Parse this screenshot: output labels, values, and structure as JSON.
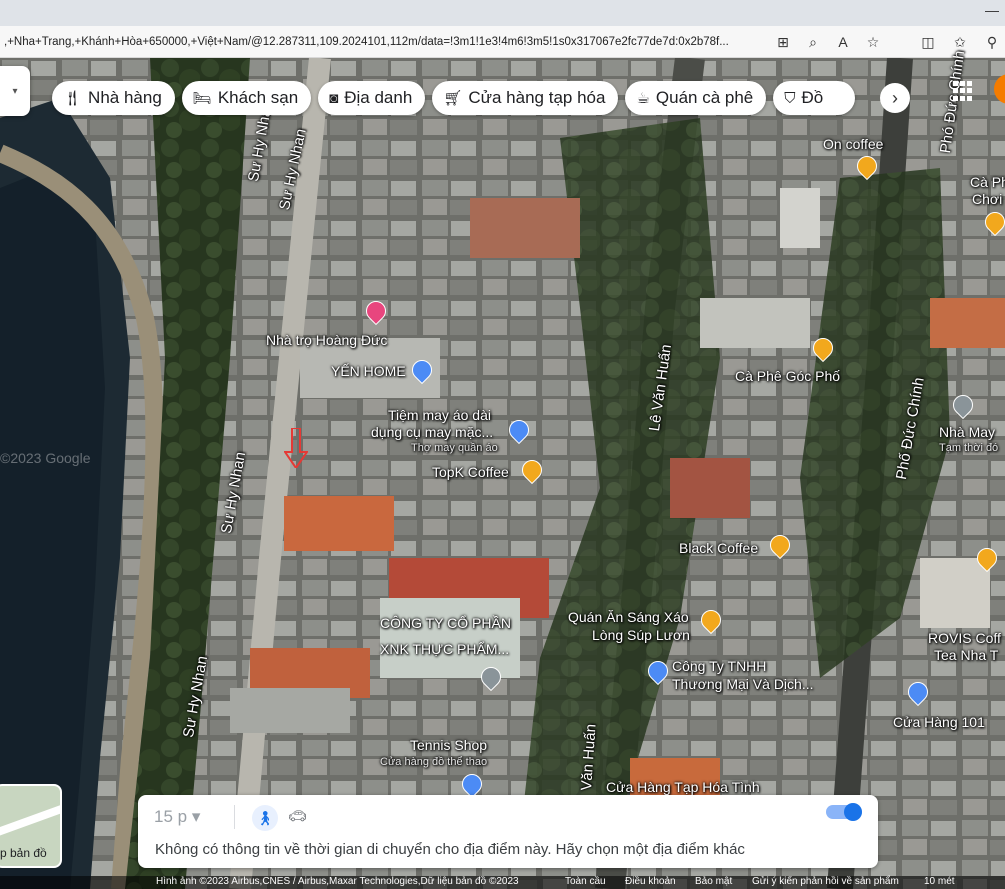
{
  "browser": {
    "url": ",+Nha+Trang,+Khánh+Hòa+650000,+Việt+Nam/@12.287311,109.2024101,112m/data=!3m1!1e3!4m6!3m5!1s0x317067e2fc77de7d:0x2b78f..."
  },
  "chips": [
    {
      "label": "Nhà hàng",
      "icon": "restaurant-icon"
    },
    {
      "label": "Khách sạn",
      "icon": "hotel-icon"
    },
    {
      "label": "Địa danh",
      "icon": "landmark-icon"
    },
    {
      "label": "Cửa hàng tạp hóa",
      "icon": "cart-icon"
    },
    {
      "label": "Quán cà phê",
      "icon": "coffee-icon"
    },
    {
      "label": "Đồ",
      "icon": "shopping-bag-icon"
    }
  ],
  "map": {
    "streets": [
      "Sư Hy Nhan",
      "Sư Hy Nhan",
      "Sư Hy Nhan",
      "Sư Hy Nhan",
      "Lê Văn Huấn",
      "Phó Đức Chính",
      "Phố Đức Chính",
      "Văn Huấn"
    ],
    "places": [
      {
        "name": "On coffee",
        "type": "cafe"
      },
      {
        "name": "Cà Phê Góc Phố",
        "type": "cafe"
      },
      {
        "name": "Nhà trọ Hoàng Đức",
        "type": "hotel"
      },
      {
        "name": "YẾN HOME",
        "type": "shop"
      },
      {
        "name": "Tiệm may áo dài",
        "sub": "dụng cụ may mặc...",
        "sub2": "Thợ may quần áo",
        "type": "shop"
      },
      {
        "name": "TopK Coffee",
        "type": "cafe"
      },
      {
        "name": "Black Coffee",
        "type": "cafe"
      },
      {
        "name": "Quán Ăn Sáng Xáo",
        "sub": "Lòng Súp Lươn",
        "type": "food"
      },
      {
        "name": "CÔNG TY CỔ PHẦN",
        "sub": "XNK THỰC PHẨM...",
        "type": "grey"
      },
      {
        "name": "Công Ty TNHH",
        "sub": "Thương Mại Và Dịch...",
        "type": "shop"
      },
      {
        "name": "Tennis Shop",
        "sub": "Cửa hàng đồ thể thao",
        "type": "shop"
      },
      {
        "name": "Cửa Hàng Tạp Hóa Tình",
        "type": "shop"
      },
      {
        "name": "Nhà May",
        "sub": "Tạm thời đó",
        "type": "grey"
      },
      {
        "name": "ROVIS Coff",
        "sub": "Tea Nha T",
        "type": "cafe"
      },
      {
        "name": "Cửa Hàng 101",
        "type": "shop"
      },
      {
        "name": "Cà Ph",
        "sub": "Chơi",
        "type": "cafe"
      }
    ],
    "watermark": "©2023 Google"
  },
  "directions": {
    "time_select": "15 p",
    "message": "Không có thông tin về thời gian di chuyển cho địa điểm này. Hãy chọn một địa điểm khác"
  },
  "layers": {
    "label": "p bản đồ"
  },
  "footer": {
    "attribution": "Hình ảnh ©2023 Airbus,CNES / Airbus,Maxar Technologies,Dữ liệu bản đồ ©2023",
    "global": "Toàn cầu",
    "terms": "Điều khoản",
    "privacy": "Bảo mật",
    "feedback": "Gửi ý kiến phản hồi về sản phẩm",
    "scale": "10 mét"
  }
}
